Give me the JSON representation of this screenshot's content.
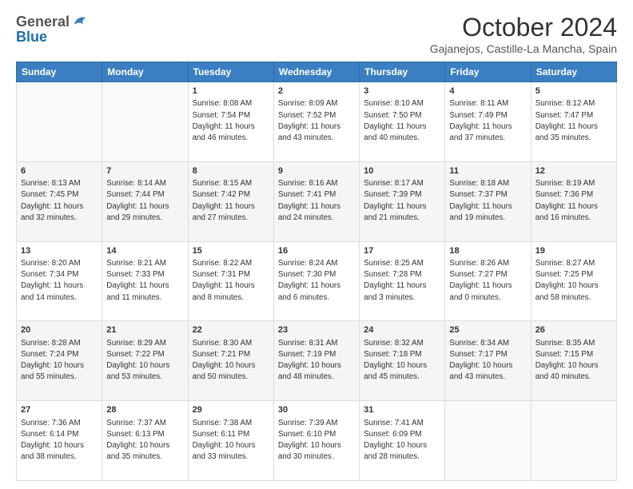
{
  "header": {
    "logo_general": "General",
    "logo_blue": "Blue",
    "month_title": "October 2024",
    "location": "Gajanejos, Castille-La Mancha, Spain"
  },
  "days_of_week": [
    "Sunday",
    "Monday",
    "Tuesday",
    "Wednesday",
    "Thursday",
    "Friday",
    "Saturday"
  ],
  "weeks": [
    [
      {
        "day": "",
        "info": ""
      },
      {
        "day": "",
        "info": ""
      },
      {
        "day": "1",
        "info": "Sunrise: 8:08 AM\nSunset: 7:54 PM\nDaylight: 11 hours and 46 minutes."
      },
      {
        "day": "2",
        "info": "Sunrise: 8:09 AM\nSunset: 7:52 PM\nDaylight: 11 hours and 43 minutes."
      },
      {
        "day": "3",
        "info": "Sunrise: 8:10 AM\nSunset: 7:50 PM\nDaylight: 11 hours and 40 minutes."
      },
      {
        "day": "4",
        "info": "Sunrise: 8:11 AM\nSunset: 7:49 PM\nDaylight: 11 hours and 37 minutes."
      },
      {
        "day": "5",
        "info": "Sunrise: 8:12 AM\nSunset: 7:47 PM\nDaylight: 11 hours and 35 minutes."
      }
    ],
    [
      {
        "day": "6",
        "info": "Sunrise: 8:13 AM\nSunset: 7:45 PM\nDaylight: 11 hours and 32 minutes."
      },
      {
        "day": "7",
        "info": "Sunrise: 8:14 AM\nSunset: 7:44 PM\nDaylight: 11 hours and 29 minutes."
      },
      {
        "day": "8",
        "info": "Sunrise: 8:15 AM\nSunset: 7:42 PM\nDaylight: 11 hours and 27 minutes."
      },
      {
        "day": "9",
        "info": "Sunrise: 8:16 AM\nSunset: 7:41 PM\nDaylight: 11 hours and 24 minutes."
      },
      {
        "day": "10",
        "info": "Sunrise: 8:17 AM\nSunset: 7:39 PM\nDaylight: 11 hours and 21 minutes."
      },
      {
        "day": "11",
        "info": "Sunrise: 8:18 AM\nSunset: 7:37 PM\nDaylight: 11 hours and 19 minutes."
      },
      {
        "day": "12",
        "info": "Sunrise: 8:19 AM\nSunset: 7:36 PM\nDaylight: 11 hours and 16 minutes."
      }
    ],
    [
      {
        "day": "13",
        "info": "Sunrise: 8:20 AM\nSunset: 7:34 PM\nDaylight: 11 hours and 14 minutes."
      },
      {
        "day": "14",
        "info": "Sunrise: 8:21 AM\nSunset: 7:33 PM\nDaylight: 11 hours and 11 minutes."
      },
      {
        "day": "15",
        "info": "Sunrise: 8:22 AM\nSunset: 7:31 PM\nDaylight: 11 hours and 8 minutes."
      },
      {
        "day": "16",
        "info": "Sunrise: 8:24 AM\nSunset: 7:30 PM\nDaylight: 11 hours and 6 minutes."
      },
      {
        "day": "17",
        "info": "Sunrise: 8:25 AM\nSunset: 7:28 PM\nDaylight: 11 hours and 3 minutes."
      },
      {
        "day": "18",
        "info": "Sunrise: 8:26 AM\nSunset: 7:27 PM\nDaylight: 11 hours and 0 minutes."
      },
      {
        "day": "19",
        "info": "Sunrise: 8:27 AM\nSunset: 7:25 PM\nDaylight: 10 hours and 58 minutes."
      }
    ],
    [
      {
        "day": "20",
        "info": "Sunrise: 8:28 AM\nSunset: 7:24 PM\nDaylight: 10 hours and 55 minutes."
      },
      {
        "day": "21",
        "info": "Sunrise: 8:29 AM\nSunset: 7:22 PM\nDaylight: 10 hours and 53 minutes."
      },
      {
        "day": "22",
        "info": "Sunrise: 8:30 AM\nSunset: 7:21 PM\nDaylight: 10 hours and 50 minutes."
      },
      {
        "day": "23",
        "info": "Sunrise: 8:31 AM\nSunset: 7:19 PM\nDaylight: 10 hours and 48 minutes."
      },
      {
        "day": "24",
        "info": "Sunrise: 8:32 AM\nSunset: 7:18 PM\nDaylight: 10 hours and 45 minutes."
      },
      {
        "day": "25",
        "info": "Sunrise: 8:34 AM\nSunset: 7:17 PM\nDaylight: 10 hours and 43 minutes."
      },
      {
        "day": "26",
        "info": "Sunrise: 8:35 AM\nSunset: 7:15 PM\nDaylight: 10 hours and 40 minutes."
      }
    ],
    [
      {
        "day": "27",
        "info": "Sunrise: 7:36 AM\nSunset: 6:14 PM\nDaylight: 10 hours and 38 minutes."
      },
      {
        "day": "28",
        "info": "Sunrise: 7:37 AM\nSunset: 6:13 PM\nDaylight: 10 hours and 35 minutes."
      },
      {
        "day": "29",
        "info": "Sunrise: 7:38 AM\nSunset: 6:11 PM\nDaylight: 10 hours and 33 minutes."
      },
      {
        "day": "30",
        "info": "Sunrise: 7:39 AM\nSunset: 6:10 PM\nDaylight: 10 hours and 30 minutes."
      },
      {
        "day": "31",
        "info": "Sunrise: 7:41 AM\nSunset: 6:09 PM\nDaylight: 10 hours and 28 minutes."
      },
      {
        "day": "",
        "info": ""
      },
      {
        "day": "",
        "info": ""
      }
    ]
  ]
}
